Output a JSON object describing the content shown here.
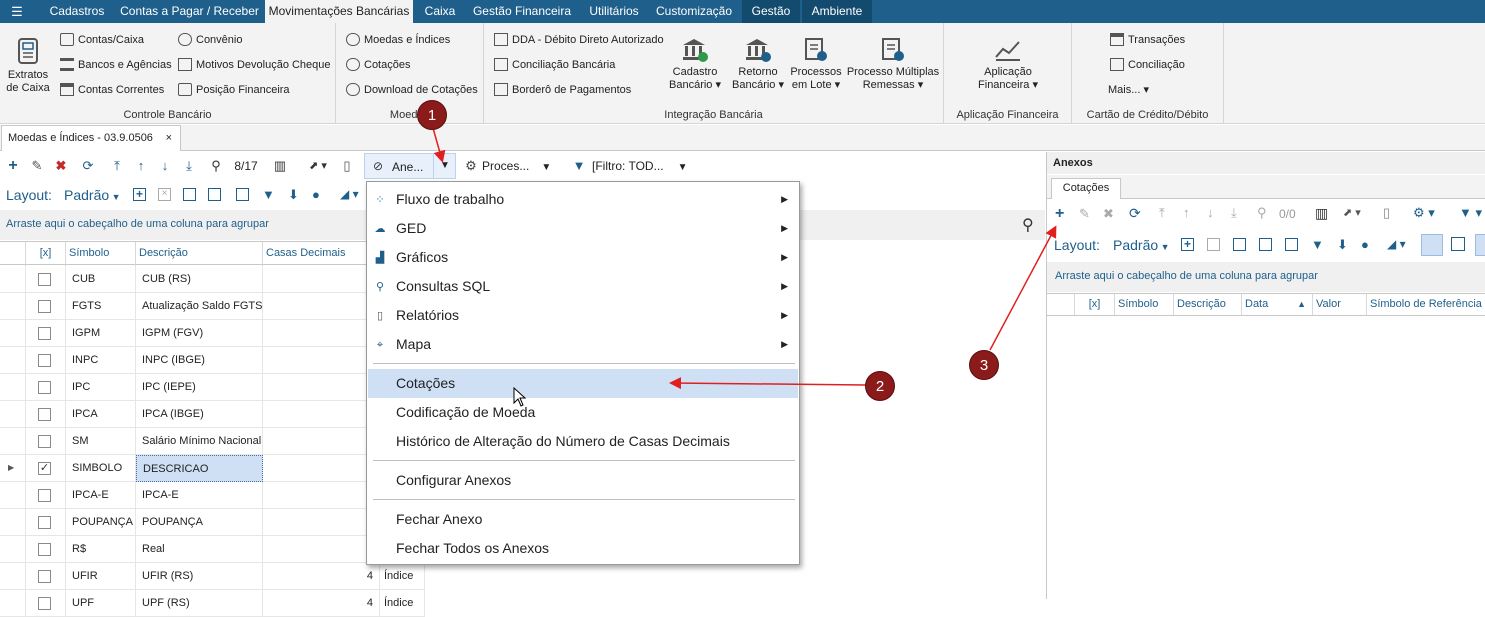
{
  "menubar": {
    "tabs": [
      "Cadastros",
      "Contas a Pagar / Receber",
      "Movimentações Bancárias",
      "Caixa",
      "Gestão Financeira",
      "Utilitários",
      "Customização",
      "Gestão",
      "Ambiente"
    ]
  },
  "ribbon": {
    "extratos": {
      "line1": "Extratos",
      "line2": "de Caixa"
    },
    "controle": {
      "items": [
        "Contas/Caixa",
        "Bancos e Agências",
        "Contas Correntes",
        "Convênio",
        "Motivos Devolução Cheque",
        "Posição Financeira"
      ],
      "label": "Controle Bancário"
    },
    "moedas": {
      "items": [
        "Moedas e Índices",
        "Cotações",
        "Download de Cotações"
      ],
      "label": "Moedas"
    },
    "integracao": {
      "items": [
        "DDA - Débito Direto Autorizado",
        "Conciliação Bancária",
        "Borderô de Pagamentos"
      ],
      "big": [
        {
          "line1": "Cadastro",
          "line2": "Bancário"
        },
        {
          "line1": "Retorno",
          "line2": "Bancário"
        },
        {
          "line1": "Processos",
          "line2": "em Lote"
        },
        {
          "line1": "Processo Múltiplas",
          "line2": "Remessas"
        }
      ],
      "label": "Integração Bancária"
    },
    "aplicacao": {
      "line1": "Aplicação",
      "line2": "Financeira",
      "label": "Aplicação Financeira"
    },
    "cartao": {
      "items": [
        "Transações",
        "Conciliação",
        "Mais..."
      ],
      "label": "Cartão de Crédito/Débito"
    }
  },
  "doctab": {
    "title": "Moedas e Índices - 03.9.0506",
    "close": "×"
  },
  "toolbar": {
    "record": "8/17",
    "anexos": "Ane...",
    "processos": "Proces...",
    "filtro": "[Filtro: TOD..."
  },
  "layoutbar": {
    "label": "Layout:",
    "value": "Padrão"
  },
  "grid": {
    "group_hint": "Arraste aqui o cabeçalho de uma coluna para agrupar",
    "headers": {
      "sel": "[x]",
      "simbolo": "Símbolo",
      "descricao": "Descrição",
      "casas": "Casas Decimais"
    },
    "rows": [
      {
        "check": "",
        "simbolo": "CUB",
        "descricao": "CUB (RS)"
      },
      {
        "check": "",
        "simbolo": "FGTS",
        "descricao": "Atualização Saldo FGTS"
      },
      {
        "check": "",
        "simbolo": "IGPM",
        "descricao": "IGPM (FGV)"
      },
      {
        "check": "",
        "simbolo": "INPC",
        "descricao": "INPC (IBGE)"
      },
      {
        "check": "",
        "simbolo": "IPC",
        "descricao": "IPC (IEPE)"
      },
      {
        "check": "",
        "simbolo": "IPCA",
        "descricao": "IPCA (IBGE)"
      },
      {
        "check": "",
        "simbolo": "SM",
        "descricao": "Salário Mínimo Nacional"
      },
      {
        "check": "✓",
        "simbolo": "SIMBOLO",
        "descricao": "DESCRICAO"
      },
      {
        "check": "",
        "simbolo": "IPCA-E",
        "descricao": "IPCA-E"
      },
      {
        "check": "",
        "simbolo": "POUPANÇA",
        "descricao": "POUPANÇA"
      },
      {
        "check": "",
        "simbolo": "R$",
        "descricao": "Real"
      },
      {
        "check": "",
        "simbolo": "UFIR",
        "descricao": "UFIR (RS)",
        "casas": "4",
        "tipo": "Índice"
      },
      {
        "check": "",
        "simbolo": "UPF",
        "descricao": "UPF (RS)",
        "casas": "4",
        "tipo": "Índice"
      }
    ]
  },
  "context_menu": {
    "submenus": [
      "Fluxo de trabalho",
      "GED",
      "Gráficos",
      "Consultas SQL",
      "Relatórios",
      "Mapa"
    ],
    "items": [
      "Cotações",
      "Codificação de Moeda",
      "Histórico de Alteração do Número de Casas Decimais"
    ],
    "configure": "Configurar Anexos",
    "close": [
      "Fechar Anexo",
      "Fechar Todos os Anexos"
    ]
  },
  "anexos_panel": {
    "title": "Anexos",
    "tab": "Cotações",
    "record": "0/0",
    "layout_label": "Layout:",
    "layout_value": "Padrão",
    "group_hint": "Arraste aqui o cabeçalho de uma coluna para agrupar",
    "headers": [
      "[x]",
      "Símbolo",
      "Descrição",
      "Data",
      "Valor",
      "Símbolo de Referência"
    ]
  },
  "callouts": [
    "1",
    "2",
    "3"
  ],
  "colors": {
    "brand": "#1f5f8b",
    "highlight": "#cfe0f5",
    "callout": "#8b1a1a",
    "arrow": "#e0201f"
  }
}
